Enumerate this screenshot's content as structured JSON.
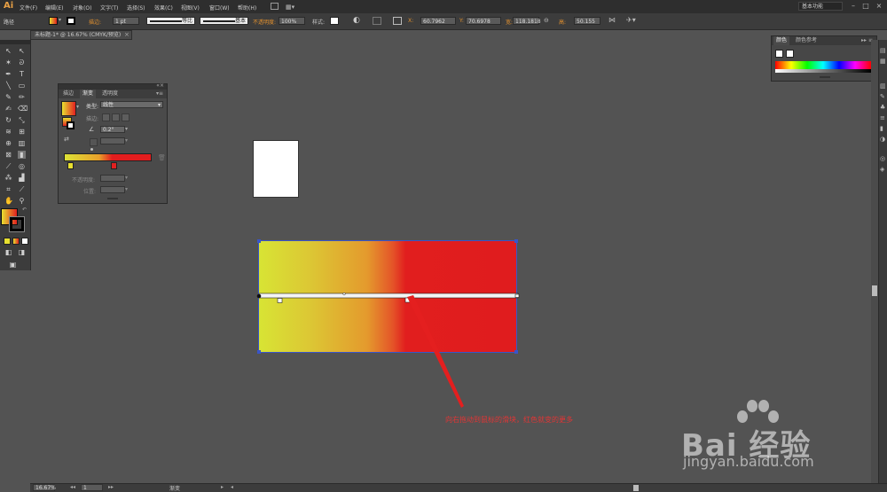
{
  "menu": {
    "app_logo": "Ai",
    "items": [
      "文件(F)",
      "编辑(E)",
      "对象(O)",
      "文字(T)",
      "选择(S)",
      "效果(C)",
      "视图(V)",
      "窗口(W)",
      "帮助(H)"
    ],
    "workspace": "基本功能"
  },
  "controlbar": {
    "object_type": "路径",
    "stroke_label": "描边:",
    "stroke_weight": "1 pt",
    "brush_profile": "等比",
    "brush_style": "基本",
    "opacity_label": "不透明度:",
    "opacity_value": "100%",
    "style_label": "样式:",
    "x_label": "X:",
    "x_value": "60.7962",
    "y_label": "Y:",
    "y_value": "70.6978",
    "w_label": "宽:",
    "w_value": "118.1818",
    "h_label": "高:",
    "h_value": "50.155"
  },
  "document": {
    "tab_title": "未标题-1* @ 16.67% (CMYK/预览)"
  },
  "gradient_panel": {
    "tabs": [
      "描边",
      "渐变",
      "透明度"
    ],
    "active_tab": "渐变",
    "type_label": "类型:",
    "type_value": "线性",
    "stroke_label": "描边:",
    "angle_value": "0.2°",
    "opacity_label": "不透明度:",
    "location_label": "位置:"
  },
  "color_panel": {
    "tabs": [
      "颜色",
      "颜色参考"
    ],
    "active_tab": "颜色"
  },
  "statusbar": {
    "zoom": "16.67%",
    "page": "1",
    "tool": "渐变"
  },
  "annotation": {
    "text": "向右拖动到鼠标的滑块，红色就变的更多",
    "color": "#e23535"
  },
  "watermark": {
    "brand": "Bai 经验",
    "url": "jingyan.baidu.com"
  },
  "colors": {
    "gradient_start": "#dce236",
    "gradient_end": "#e31d1e",
    "selection": "#3a55c8"
  }
}
